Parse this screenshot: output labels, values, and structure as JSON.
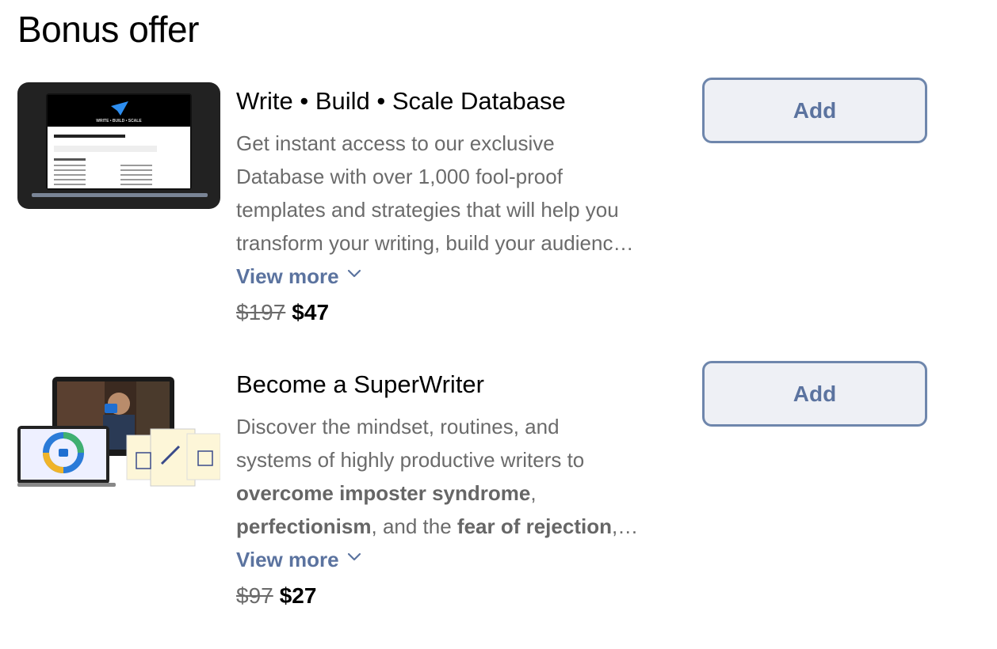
{
  "section": {
    "title": "Bonus offer"
  },
  "offers": [
    {
      "thumbnail_icon": "laptop-database-thumbnail",
      "thumbnail_text": "WRITE • BUILD • SCALE",
      "title": "Write • Build • Scale Database",
      "description_lines": [
        "Get instant access to our exclusive",
        "Database with over 1,000 fool-proof",
        "templates and strategies that will help you",
        "transform your writing, build your audienc…"
      ],
      "view_more": "View more",
      "old_price": "$197",
      "new_price": "$47",
      "button": "Add"
    },
    {
      "thumbnail_icon": "course-bundle-thumbnail",
      "title": "Become a SuperWriter",
      "description": {
        "line1": "Discover the mindset, routines, and",
        "line2": "systems of highly productive writers to",
        "line3_bold": "overcome imposter syndrome",
        "line3_rest": ",",
        "line4_bold1": "perfectionism",
        "line4_mid": ", and the ",
        "line4_bold2": "fear of rejection",
        "line4_rest": ",…"
      },
      "view_more": "View more",
      "old_price": "$97",
      "new_price": "$27",
      "button": "Add"
    }
  ]
}
